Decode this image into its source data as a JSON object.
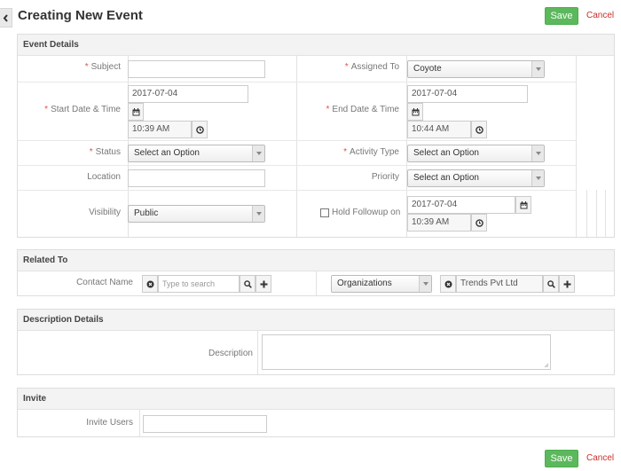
{
  "header": {
    "title": "Creating New Event",
    "save_label": "Save",
    "cancel_label": "Cancel"
  },
  "event_details": {
    "heading": "Event Details",
    "subject_label": "Subject",
    "subject_value": "",
    "assigned_to_label": "Assigned To",
    "assigned_to_value": "Coyote",
    "start_label": "Start Date & Time",
    "start_date": "2017-07-04",
    "start_time": "10:39 AM",
    "end_label": "End Date & Time",
    "end_date": "2017-07-04",
    "end_time": "10:44 AM",
    "status_label": "Status",
    "status_value": "Select an Option",
    "activity_type_label": "Activity Type",
    "activity_type_value": "Select an Option",
    "location_label": "Location",
    "location_value": "",
    "priority_label": "Priority",
    "priority_value": "Select an Option",
    "visibility_label": "Visibility",
    "visibility_value": "Public",
    "hold_followup_label": "Hold Followup on",
    "followup_date": "2017-07-04",
    "followup_time": "10:39 AM"
  },
  "related_to": {
    "heading": "Related To",
    "contact_label": "Contact Name",
    "contact_placeholder": "Type to search",
    "org_type_value": "Organizations",
    "org_value": "Trends Pvt Ltd"
  },
  "description": {
    "heading": "Description Details",
    "label": "Description"
  },
  "invite": {
    "heading": "Invite",
    "label": "Invite Users"
  },
  "footer": {
    "save_label": "Save",
    "cancel_label": "Cancel"
  },
  "icons": {
    "calendar": "calendar-icon",
    "clock": "clock-icon",
    "search": "search-icon",
    "plus": "plus-icon",
    "clear": "clear-icon",
    "collapse": "chevron-left-icon"
  },
  "colors": {
    "save_bg": "#5cb85c",
    "cancel_text": "#c9302c",
    "required": "#d9534f"
  }
}
